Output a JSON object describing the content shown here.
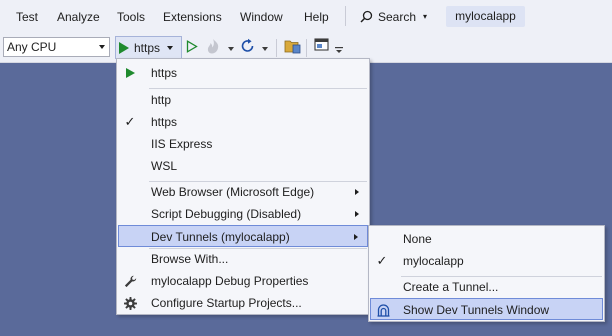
{
  "menubar": {
    "items": [
      "Test",
      "Analyze",
      "Tools",
      "Extensions",
      "Window",
      "Help"
    ],
    "search_label": "Search",
    "app_name": "mylocalapp"
  },
  "toolbar": {
    "platform_value": "Any CPU",
    "run_profile": "https"
  },
  "run_menu": {
    "top_item": "https",
    "profiles": [
      "http",
      "https",
      "IIS Express",
      "WSL"
    ],
    "checked_profile": "https",
    "web_browser": "Web Browser (Microsoft Edge)",
    "script_debugging": "Script Debugging (Disabled)",
    "dev_tunnels": "Dev Tunnels (mylocalapp)",
    "browse_with": "Browse With...",
    "debug_properties": "mylocalapp Debug Properties",
    "configure_startup": "Configure Startup Projects..."
  },
  "tunnels_menu": {
    "none": "None",
    "tunnel": "mylocalapp",
    "checked": "mylocalapp",
    "create": "Create a Tunnel...",
    "show_window": "Show Dev Tunnels Window"
  },
  "colors": {
    "background": "#5a6a9a",
    "chrome": "#eef0f7",
    "menu": "#f5f6fa",
    "highlight": "#c8d3f5",
    "run_green": "#1f8a2e"
  }
}
